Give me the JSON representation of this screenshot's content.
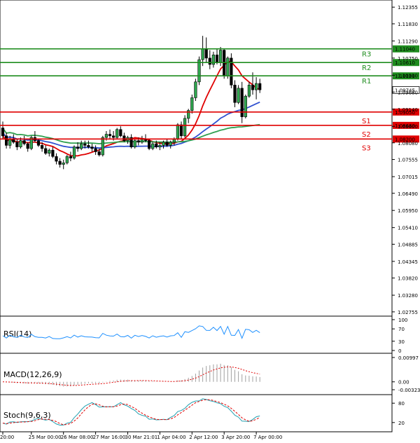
{
  "chart_data": {
    "type": "candlestick",
    "instrument_note": "",
    "price_axis": {
      "ylim": [
        1.0262,
        1.1258
      ],
      "ticks": [
        "1.12355",
        "1.11830",
        "1.11290",
        "1.10750",
        "1.10210",
        "1.09680",
        "1.09140",
        "1.08600",
        "1.08080",
        "1.07555",
        "1.07015",
        "1.06490",
        "1.05950",
        "1.05410",
        "1.04885",
        "1.04345",
        "1.03820",
        "1.03280",
        "1.02755"
      ]
    },
    "time_axis": {
      "labels": [
        "20:00",
        "25 Mar 00:00",
        "26 Mar 08:00",
        "27 Mar 16:00",
        "30 Mar 21:01",
        "1 Apr 04:00",
        "2 Apr 12:00",
        "3 Apr 20:00",
        "7 Apr 00:00"
      ],
      "label_bar_index": [
        0,
        8,
        17,
        26,
        35,
        44,
        53,
        62,
        71
      ]
    },
    "levels": [
      {
        "name": "R3",
        "value": "1.11040",
        "color": "#1e8c1e"
      },
      {
        "name": "R2",
        "value": "1.10610",
        "color": "#1e8c1e"
      },
      {
        "name": "R1",
        "value": "1.10190",
        "color": "#1e8c1e"
      },
      {
        "name": "S1",
        "value": "1.09050",
        "color": "#e00000"
      },
      {
        "name": "S2",
        "value": "1.08630",
        "color": "#e00000"
      },
      {
        "name": "S3",
        "value": "1.08200",
        "color": "#e00000"
      }
    ],
    "current_price": "1.09745",
    "candles": [
      [
        1.0855,
        1.0875,
        1.082,
        1.083
      ],
      [
        1.083,
        1.084,
        1.079,
        1.08
      ],
      [
        1.08,
        1.083,
        1.079,
        1.082
      ],
      [
        1.082,
        1.0835,
        1.0805,
        1.081
      ],
      [
        1.081,
        1.082,
        1.0785,
        1.0795
      ],
      [
        1.0795,
        1.0825,
        1.079,
        1.0815
      ],
      [
        1.0815,
        1.083,
        1.08,
        1.0805
      ],
      [
        1.0805,
        1.081,
        1.078,
        1.079
      ],
      [
        1.079,
        1.083,
        1.0785,
        1.0825
      ],
      [
        1.0825,
        1.0845,
        1.081,
        1.0815
      ],
      [
        1.0815,
        1.082,
        1.0795,
        1.08
      ],
      [
        1.08,
        1.081,
        1.078,
        1.079
      ],
      [
        1.079,
        1.08,
        1.077,
        1.0775
      ],
      [
        1.0775,
        1.079,
        1.0765,
        1.0785
      ],
      [
        1.0785,
        1.0795,
        1.076,
        1.0765
      ],
      [
        1.0765,
        1.0775,
        1.074,
        1.075
      ],
      [
        1.075,
        1.076,
        1.073,
        1.074
      ],
      [
        1.074,
        1.0755,
        1.0725,
        1.0745
      ],
      [
        1.0745,
        1.077,
        1.074,
        1.0765
      ],
      [
        1.0765,
        1.078,
        1.075,
        1.076
      ],
      [
        1.076,
        1.08,
        1.0755,
        1.0795
      ],
      [
        1.0795,
        1.081,
        1.078,
        1.079
      ],
      [
        1.079,
        1.0815,
        1.0785,
        1.0805
      ],
      [
        1.0805,
        1.0815,
        1.079,
        1.08
      ],
      [
        1.08,
        1.0815,
        1.079,
        1.0795
      ],
      [
        1.0795,
        1.0805,
        1.078,
        1.079
      ],
      [
        1.079,
        1.08,
        1.077,
        1.078
      ],
      [
        1.078,
        1.079,
        1.0765,
        1.077
      ],
      [
        1.077,
        1.083,
        1.0765,
        1.0825
      ],
      [
        1.0825,
        1.0845,
        1.0815,
        1.0835
      ],
      [
        1.0835,
        1.085,
        1.082,
        1.083
      ],
      [
        1.083,
        1.0845,
        1.0815,
        1.0825
      ],
      [
        1.0825,
        1.0855,
        1.082,
        1.085
      ],
      [
        1.085,
        1.086,
        1.0825,
        1.083
      ],
      [
        1.083,
        1.084,
        1.081,
        1.0815
      ],
      [
        1.0815,
        1.083,
        1.0805,
        1.0825
      ],
      [
        1.0825,
        1.0835,
        1.079,
        1.0795
      ],
      [
        1.0795,
        1.082,
        1.079,
        1.0815
      ],
      [
        1.0815,
        1.0825,
        1.08,
        1.081
      ],
      [
        1.081,
        1.083,
        1.0805,
        1.082
      ],
      [
        1.082,
        1.0835,
        1.081,
        1.0815
      ],
      [
        1.0815,
        1.082,
        1.0785,
        1.079
      ],
      [
        1.079,
        1.081,
        1.0785,
        1.0805
      ],
      [
        1.0805,
        1.0815,
        1.079,
        1.0795
      ],
      [
        1.0795,
        1.081,
        1.0785,
        1.08
      ],
      [
        1.08,
        1.0815,
        1.079,
        1.081
      ],
      [
        1.081,
        1.082,
        1.0795,
        1.08
      ],
      [
        1.08,
        1.0815,
        1.079,
        1.081
      ],
      [
        1.081,
        1.0825,
        1.08,
        1.082
      ],
      [
        1.082,
        1.087,
        1.0815,
        1.0865
      ],
      [
        1.0865,
        1.0875,
        1.082,
        1.083
      ],
      [
        1.083,
        1.0895,
        1.0825,
        1.0885
      ],
      [
        1.0885,
        1.0915,
        1.087,
        1.091
      ],
      [
        1.091,
        1.096,
        1.09,
        1.095
      ],
      [
        1.095,
        1.101,
        1.094,
        1.1
      ],
      [
        1.1,
        1.108,
        1.099,
        1.107
      ],
      [
        1.107,
        1.1145,
        1.105,
        1.1105
      ],
      [
        1.1105,
        1.114,
        1.106,
        1.1075
      ],
      [
        1.1075,
        1.11,
        1.104,
        1.1055
      ],
      [
        1.1055,
        1.1095,
        1.1045,
        1.1085
      ],
      [
        1.1085,
        1.1105,
        1.1055,
        1.106
      ],
      [
        1.106,
        1.111,
        1.105,
        1.11
      ],
      [
        1.11,
        1.1105,
        1.101,
        1.102
      ],
      [
        1.102,
        1.108,
        1.101,
        1.1075
      ],
      [
        1.1075,
        1.109,
        1.098,
        1.099
      ],
      [
        1.099,
        1.1005,
        1.092,
        1.0935
      ],
      [
        1.0935,
        1.099,
        1.093,
        1.098
      ],
      [
        1.098,
        1.1,
        1.087,
        1.089
      ],
      [
        1.089,
        1.096,
        1.0885,
        1.0955
      ],
      [
        1.0955,
        1.1,
        1.095,
        1.099
      ],
      [
        1.099,
        1.103,
        1.096,
        1.0975
      ],
      [
        1.0975,
        1.1015,
        1.0945,
        1.0995
      ],
      [
        1.0995,
        1.101,
        1.0965,
        1.0975
      ]
    ],
    "moving_averages": [
      {
        "color": "#e00000",
        "period": 10
      },
      {
        "color": "#3050d0",
        "period": 34
      },
      {
        "color": "#30a050",
        "period": 80
      }
    ],
    "indicators": {
      "rsi": {
        "title": "RSI(14)",
        "ticks": [
          "100",
          "70",
          "30",
          "0"
        ],
        "ylim": [
          0,
          100
        ],
        "color": "#1e90ff"
      },
      "macd": {
        "title": "MACD(12,26,9)",
        "ticks": [
          "0.00997",
          "0.00",
          "-0.003235"
        ],
        "ylim": [
          -0.003235,
          0.00997
        ],
        "hist_color": "#a0a0a0",
        "signal_color": "#e00000"
      },
      "stoch": {
        "title": "Stoch(9,6,3)",
        "ticks": [
          "80",
          "20"
        ],
        "ylim": [
          0,
          100
        ],
        "k_color": "#20a0b0",
        "d_color": "#e00000"
      }
    }
  }
}
